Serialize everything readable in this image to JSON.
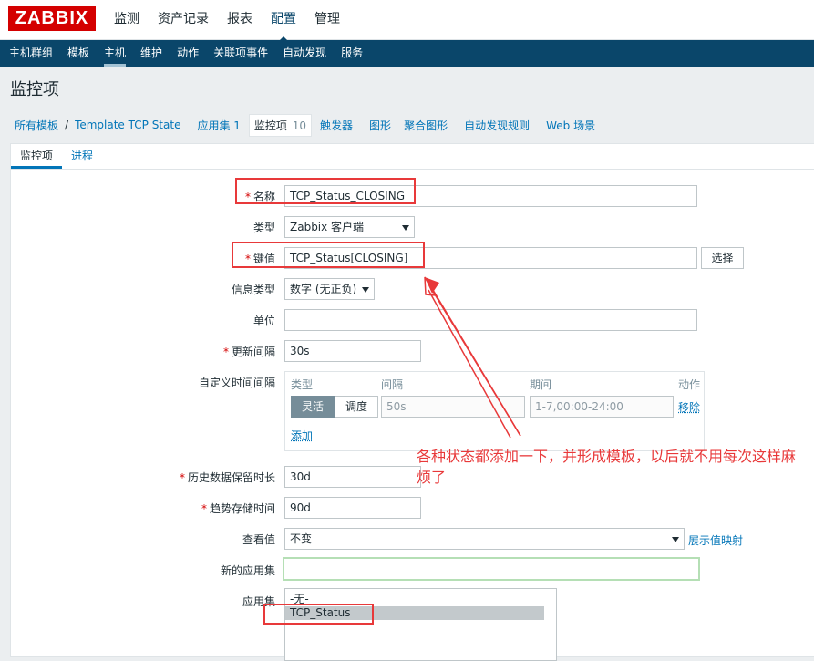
{
  "app": {
    "logo_text": "ZABBIX"
  },
  "main_menu": [
    {
      "label": "监测"
    },
    {
      "label": "资产记录"
    },
    {
      "label": "报表"
    },
    {
      "label": "配置",
      "active": true
    },
    {
      "label": "管理"
    }
  ],
  "sub_menu": [
    {
      "label": "主机群组"
    },
    {
      "label": "模板"
    },
    {
      "label": "主机",
      "active": true
    },
    {
      "label": "维护"
    },
    {
      "label": "动作"
    },
    {
      "label": "关联项事件"
    },
    {
      "label": "自动发现"
    },
    {
      "label": "服务"
    }
  ],
  "page_title": "监控项",
  "breadcrumbs": {
    "all_templates": "所有模板",
    "separator": "/",
    "template": "Template TCP State",
    "applications": "应用集 1",
    "items": "监控项",
    "items_count": "10",
    "triggers": "触发器",
    "graphs": "图形",
    "screens": "聚合图形",
    "discovery": "自动发现规则",
    "web": "Web 场景"
  },
  "tabs": {
    "item": "监控项",
    "process": "进程"
  },
  "form": {
    "name_label": "名称",
    "name_value": "TCP_Status_CLOSING",
    "type_label": "类型",
    "type_value": "Zabbix 客户端",
    "key_label": "键值",
    "key_value": "TCP_Status[CLOSING]",
    "select_button": "选择",
    "info_type_label": "信息类型",
    "info_type_value": "数字 (无正负)",
    "units_label": "单位",
    "units_value": "",
    "update_label": "更新间隔",
    "update_value": "30s",
    "custom_intervals_label": "自定义时间间隔",
    "intervals": {
      "col_type": "类型",
      "col_interval": "间隔",
      "col_period": "期间",
      "col_action": "动作",
      "flexible": "灵活",
      "scheduling": "调度",
      "interval_value": "50s",
      "period_value": "1-7,00:00-24:00",
      "remove": "移除",
      "add": "添加"
    },
    "history_label": "历史数据保留时长",
    "history_value": "30d",
    "trends_label": "趋势存储时间",
    "trends_value": "90d",
    "valuemap_label": "查看值",
    "valuemap_value": "不变",
    "valuemap_link": "展示值映射",
    "new_app_label": "新的应用集",
    "new_app_value": "",
    "apps_label": "应用集",
    "apps_options": [
      "-无-",
      "TCP_Status"
    ]
  },
  "annotation": {
    "text": "各种状态都添加一下，并形成模板，以后就不用每次这样麻烦了",
    "color": "#e8393a"
  },
  "colors": {
    "brand": "#d40000",
    "nav": "#0a466a",
    "link": "#0275b8"
  }
}
